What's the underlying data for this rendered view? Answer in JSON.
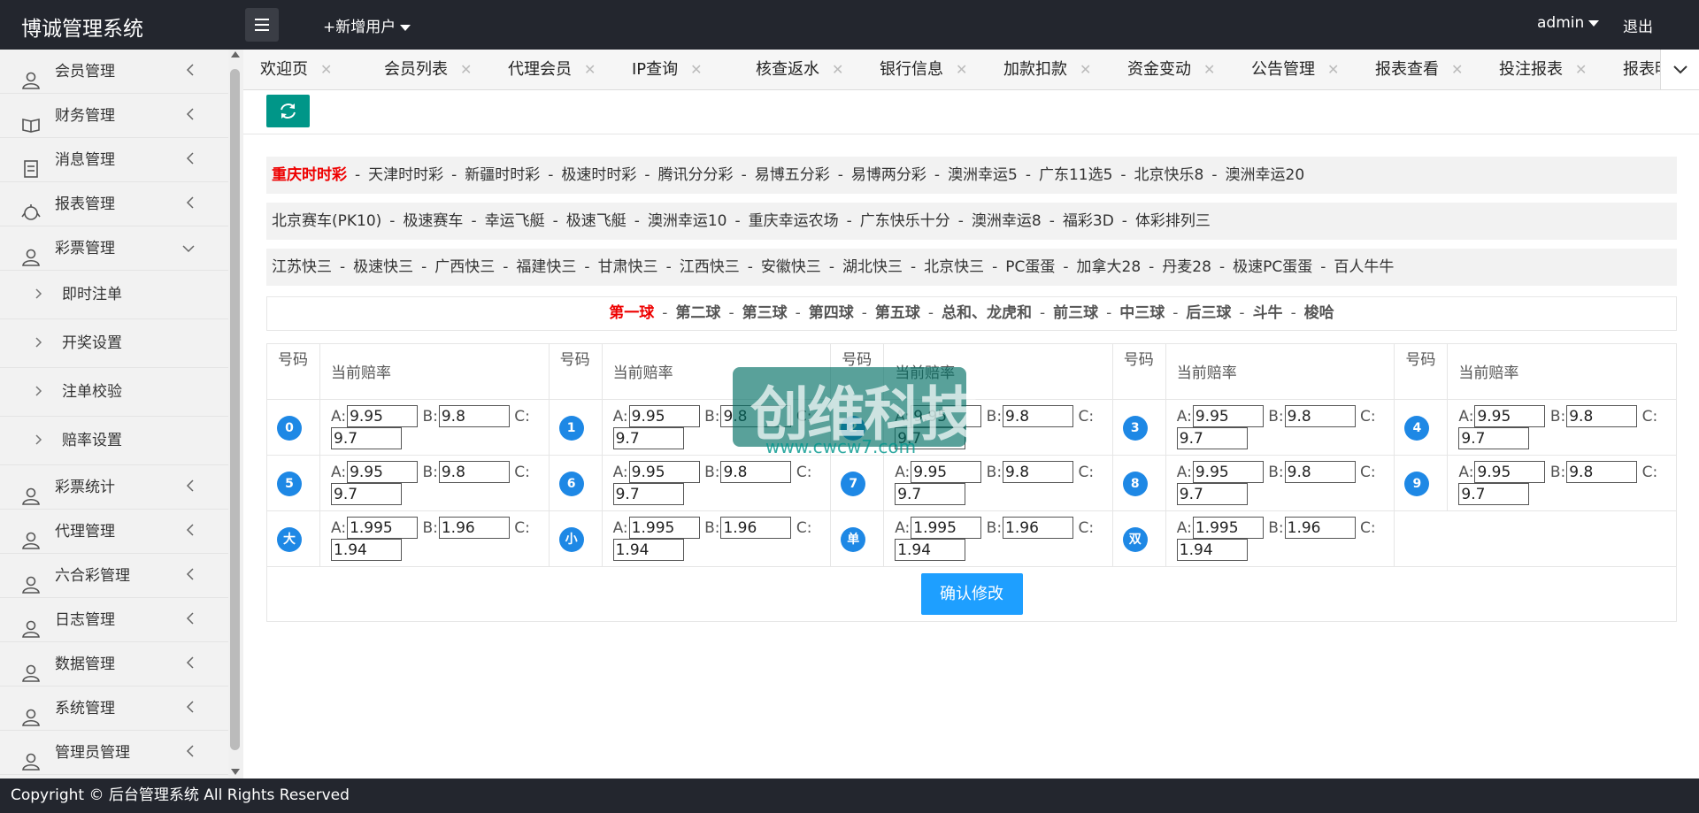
{
  "app": {
    "title": "博诚管理系统",
    "add_user": "+新增用户",
    "admin": "admin",
    "logout": "退出"
  },
  "sidebar": {
    "items": [
      {
        "label": "会员管理",
        "icon": "user-icon"
      },
      {
        "label": "财务管理",
        "icon": "book-icon"
      },
      {
        "label": "消息管理",
        "icon": "message-icon"
      },
      {
        "label": "报表管理",
        "icon": "chart-icon"
      },
      {
        "label": "彩票管理",
        "icon": "user-icon",
        "expanded": true
      }
    ],
    "subitems": [
      "即时注单",
      "开奖设置",
      "注单校验",
      "赔率设置"
    ],
    "items2": [
      {
        "label": "彩票统计",
        "icon": "user-icon"
      },
      {
        "label": "代理管理",
        "icon": "user-icon"
      },
      {
        "label": "六合彩管理",
        "icon": "user-icon"
      },
      {
        "label": "日志管理",
        "icon": "user-icon"
      },
      {
        "label": "数据管理",
        "icon": "user-icon"
      },
      {
        "label": "系统管理",
        "icon": "user-icon"
      },
      {
        "label": "管理员管理",
        "icon": "user-icon"
      }
    ]
  },
  "tabs": [
    "欢迎页",
    "会员列表",
    "代理会员",
    "IP查询",
    "核查返水",
    "银行信息",
    "加款扣款",
    "资金变动",
    "公告管理",
    "报表查看",
    "投注报表",
    "报表明细"
  ],
  "categories": [
    [
      "重庆时时彩",
      "天津时时彩",
      "新疆时时彩",
      "极速时时彩",
      "腾讯分分彩",
      "易博五分彩",
      "易博两分彩",
      "澳洲幸运5",
      "广东11选5",
      "北京快乐8",
      "澳洲幸运20"
    ],
    [
      "北京赛车(PK10)",
      "极速赛车",
      "幸运飞艇",
      "极速飞艇",
      "澳洲幸运10",
      "重庆幸运农场",
      "广东快乐十分",
      "澳洲幸运8",
      "福彩3D",
      "体彩排列三"
    ],
    [
      "江苏快三",
      "极速快三",
      "广西快三",
      "福建快三",
      "甘肃快三",
      "江西快三",
      "安徽快三",
      "湖北快三",
      "北京快三",
      "PC蛋蛋",
      "加拿大28",
      "丹麦28",
      "极速PC蛋蛋",
      "百人牛牛"
    ]
  ],
  "active_category": "重庆时时彩",
  "balls": [
    "第一球",
    "第二球",
    "第三球",
    "第四球",
    "第五球",
    "总和、龙虎和",
    "前三球",
    "中三球",
    "后三球",
    "斗牛",
    "梭哈"
  ],
  "active_ball": "第一球",
  "table": {
    "header_num": "号码",
    "header_odds": "当前赔率",
    "labels": {
      "a": "A:",
      "b": "B:",
      "c": "C:"
    },
    "rows": [
      [
        {
          "num": "0",
          "a": "9.95",
          "b": "9.8",
          "c": "9.7"
        },
        {
          "num": "1",
          "a": "9.95",
          "b": "9.8",
          "c": "9.7"
        },
        {
          "num": "2",
          "a": "9.95",
          "b": "9.8",
          "c": "9.7"
        },
        {
          "num": "3",
          "a": "9.95",
          "b": "9.8",
          "c": "9.7"
        },
        {
          "num": "4",
          "a": "9.95",
          "b": "9.8",
          "c": "9.7"
        }
      ],
      [
        {
          "num": "5",
          "a": "9.95",
          "b": "9.8",
          "c": "9.7"
        },
        {
          "num": "6",
          "a": "9.95",
          "b": "9.8",
          "c": "9.7"
        },
        {
          "num": "7",
          "a": "9.95",
          "b": "9.8",
          "c": "9.7"
        },
        {
          "num": "8",
          "a": "9.95",
          "b": "9.8",
          "c": "9.7"
        },
        {
          "num": "9",
          "a": "9.95",
          "b": "9.8",
          "c": "9.7"
        }
      ],
      [
        {
          "num": "大",
          "a": "1.995",
          "b": "1.96",
          "c": "1.94"
        },
        {
          "num": "小",
          "a": "1.995",
          "b": "1.96",
          "c": "1.94"
        },
        {
          "num": "单",
          "a": "1.995",
          "b": "1.96",
          "c": "1.94"
        },
        {
          "num": "双",
          "a": "1.995",
          "b": "1.96",
          "c": "1.94"
        }
      ]
    ]
  },
  "confirm_label": "确认修改",
  "watermark": {
    "text": "创维科技",
    "url": "www.cwcw7.com"
  },
  "footer": "Copyright © 后台管理系统 All Rights Reserved",
  "colors": {
    "topbar": "#23262e",
    "accent": "#009688",
    "primary": "#1e9fff",
    "active": "#ee0000",
    "ball": "#1e88e5"
  }
}
